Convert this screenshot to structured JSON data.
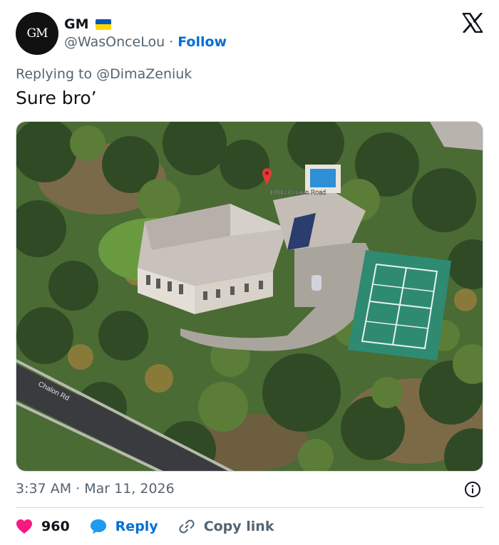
{
  "author": {
    "avatar_text": "GM",
    "display_name": "GM",
    "flag_icon": "ukraine-flag-icon",
    "handle": "@WasOnceLou",
    "separator": "·",
    "follow_label": "Follow"
  },
  "brand_icon": "x-logo-icon",
  "reply": {
    "prefix": "Replying to",
    "target": "@DimaZeniuk"
  },
  "tweet_text": "Sure bro’",
  "media": {
    "pin_label": "10911 Chalon Road",
    "street_label": "Chalon Rd"
  },
  "timestamp": "3:37 AM · Mar 11, 2026",
  "actions": {
    "likes_count": "960",
    "reply_label": "Reply",
    "copy_link_label": "Copy link"
  },
  "colors": {
    "link_blue": "#006fd6",
    "muted_gray": "#536471",
    "heart_pink": "#f91880",
    "reply_blue": "#1d9bf0"
  }
}
